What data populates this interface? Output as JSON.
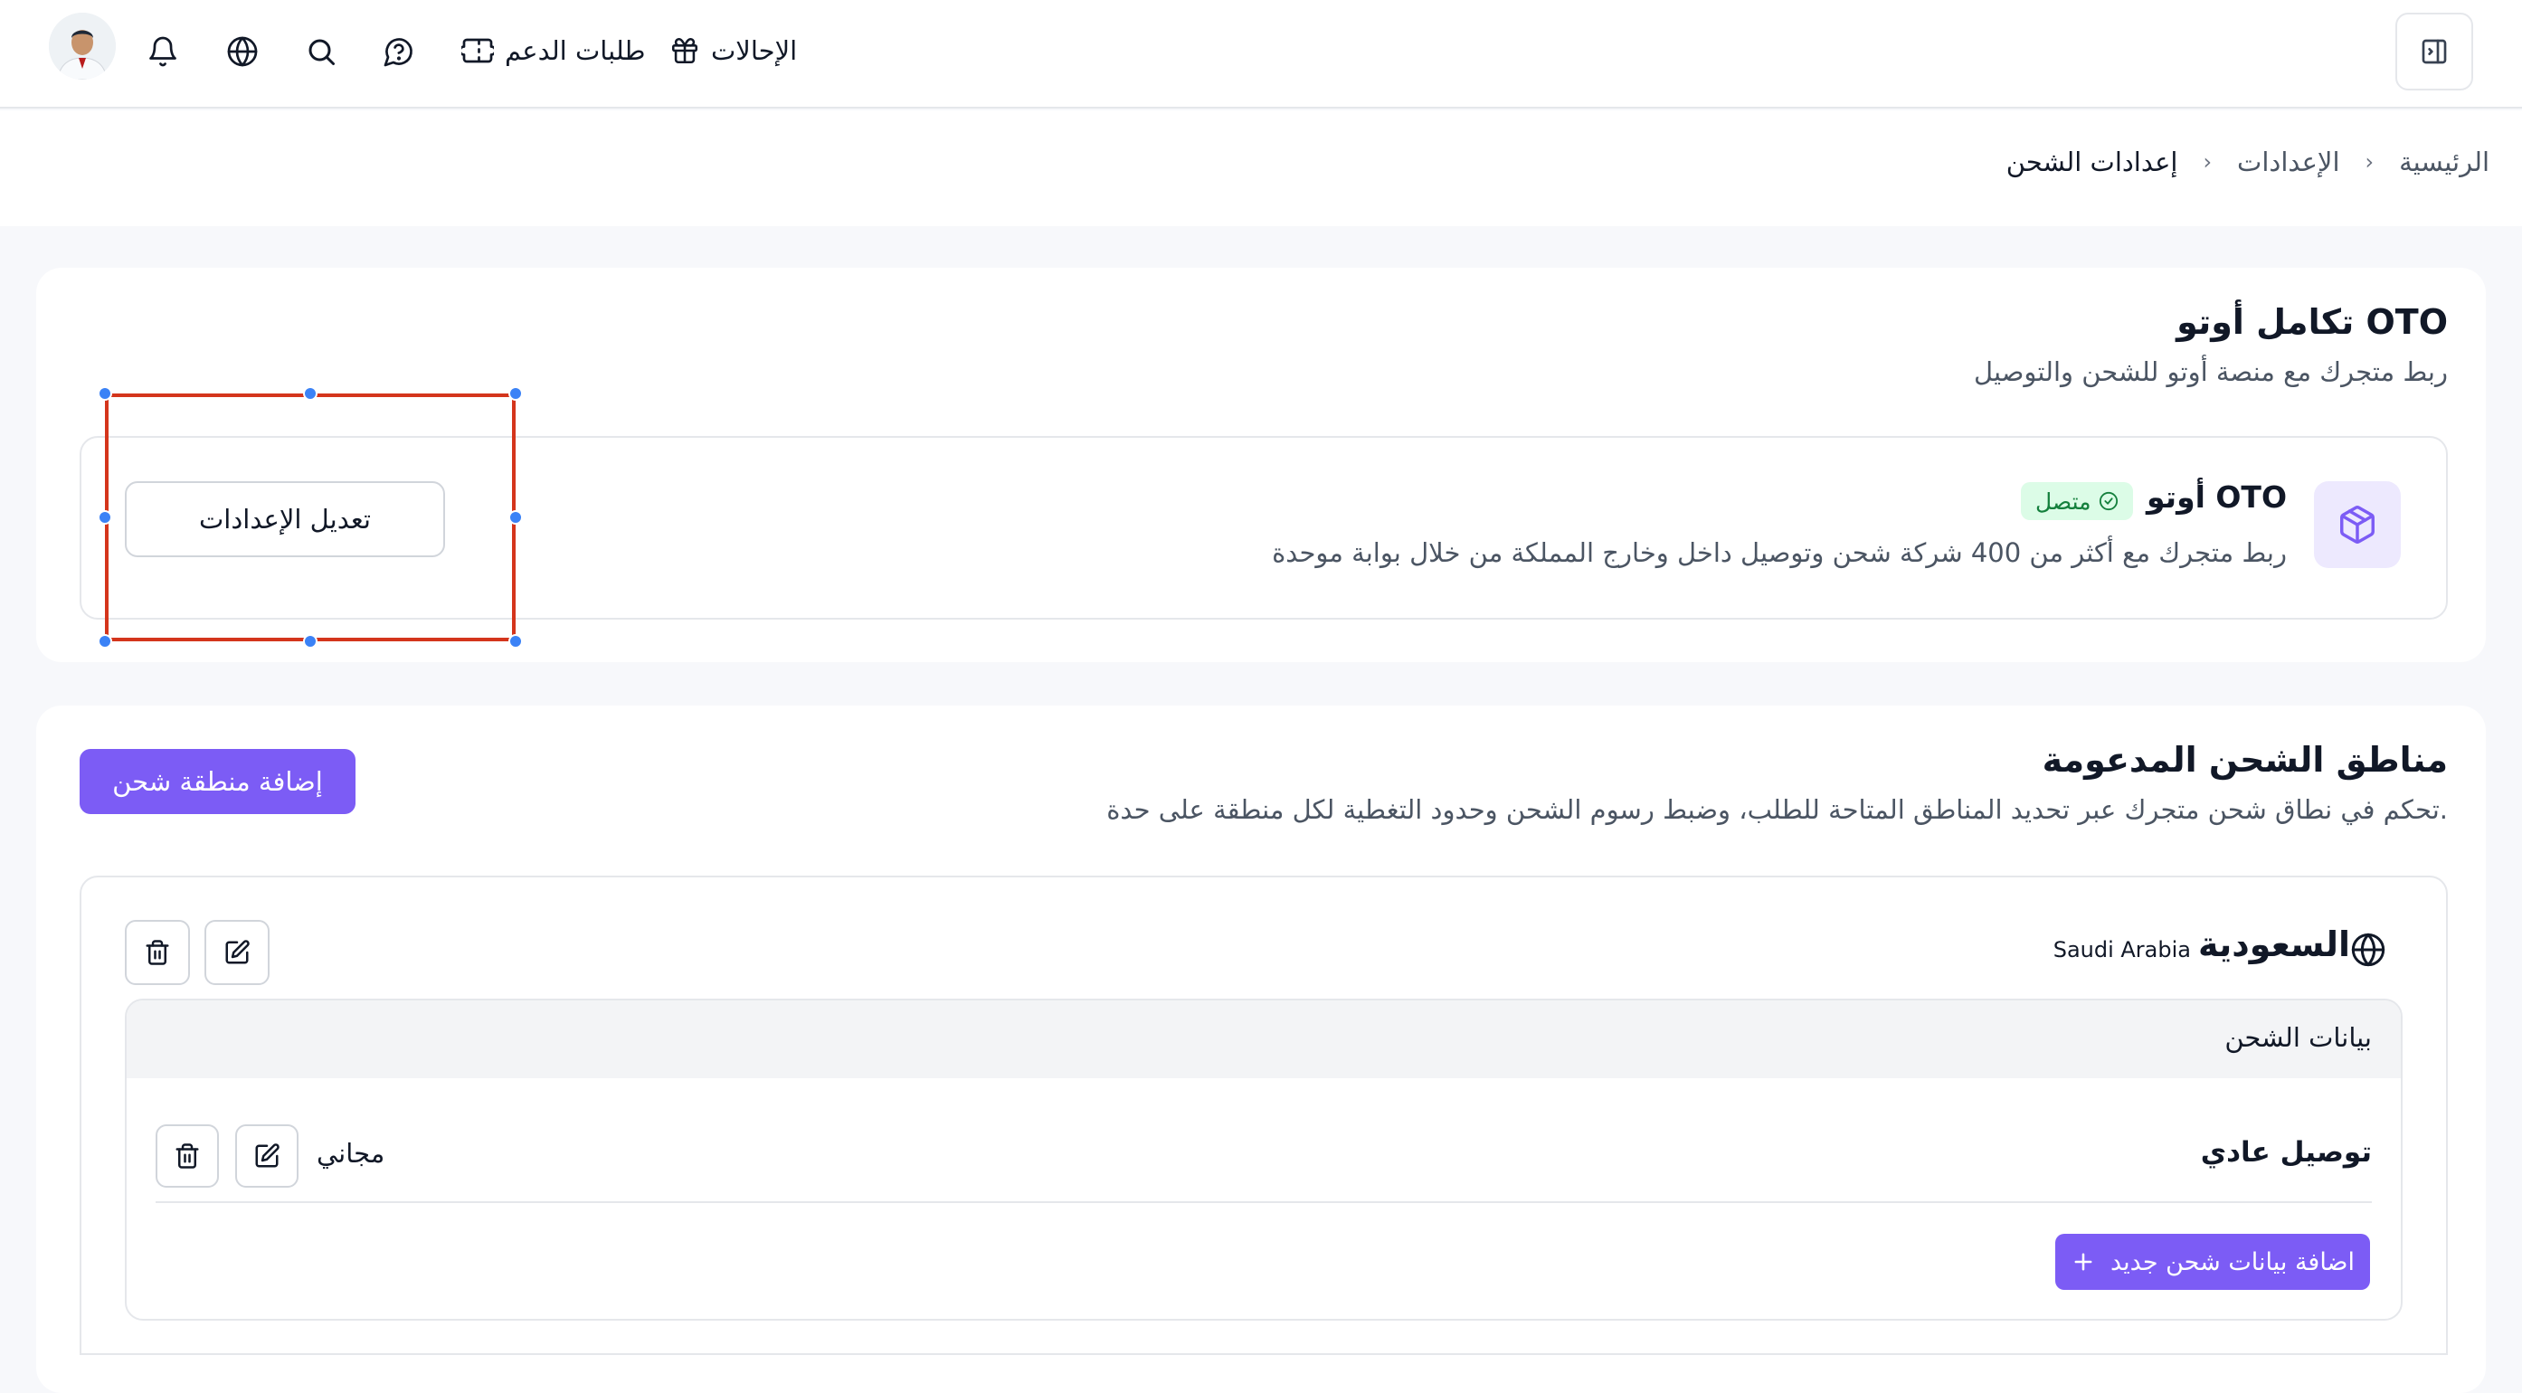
{
  "header": {
    "nav": {
      "referrals_label": "الإحالات",
      "support_label": "طلبات الدعم"
    },
    "icons": [
      "panel-toggle-icon",
      "gift-icon",
      "ticket-icon",
      "help-chat-icon",
      "search-icon",
      "globe-icon",
      "bell-icon",
      "avatar"
    ]
  },
  "breadcrumb": {
    "items": [
      "الرئيسية",
      "الإعدادات"
    ],
    "current": "إعدادات الشحن"
  },
  "oto_section": {
    "title": "تكامل أوتو OTO",
    "subtitle": "ربط متجرك مع منصة أوتو للشحن والتوصيل",
    "integration": {
      "name": "أوتو OTO",
      "status": "متصل",
      "description": "ربط متجرك مع أكثر من 400 شركة شحن وتوصيل داخل وخارج المملكة من خلال بوابة موحدة",
      "edit_button": "تعديل الإعدادات"
    }
  },
  "zones_section": {
    "title": "مناطق الشحن المدعومة",
    "subtitle": "تحكم في نطاق شحن متجرك عبر تحديد المناطق المتاحة للطلب، وضبط رسوم الشحن وحدود التغطية لكل منطقة على حدة.",
    "add_zone_button": "إضافة منطقة شحن",
    "zones": [
      {
        "name": "السعودية",
        "name_en": "Saudi Arabia",
        "shipping_header": "بيانات الشحن",
        "methods": [
          {
            "name": "توصيل عادي",
            "price": "مجاني"
          }
        ],
        "add_shipping_button": "اضافة بيانات شحن جديد"
      }
    ]
  },
  "colors": {
    "primary": "#7c5cf5",
    "status_green_bg": "#dcfce7",
    "status_green_text": "#15803d",
    "selection_red": "#d4351c",
    "handle_blue": "#3b82f6"
  }
}
